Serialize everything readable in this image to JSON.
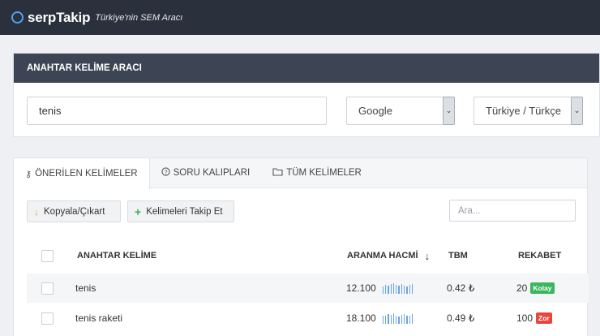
{
  "app": {
    "brand": "serpTakip",
    "tagline": "Türkiye'nin SEM Aracı"
  },
  "tool": {
    "title": "ANAHTAR KELİME ARACI",
    "keyword": "tenis",
    "engine": "Google",
    "country": "Türkiye / Türkçe"
  },
  "tabs": [
    {
      "label": "ÖNERİLEN KELİMELER",
      "icon": "key-icon",
      "active": true
    },
    {
      "label": "SORU KALIPLARI",
      "icon": "question-circle-icon",
      "active": false
    },
    {
      "label": "TÜM KELİMELER",
      "icon": "folder-icon",
      "active": false
    }
  ],
  "toolbar": {
    "copy_label": "Kopyala/Çıkart",
    "track_label": "Kelimeleri Takip Et",
    "search_placeholder": "Ara..."
  },
  "table": {
    "columns": {
      "keyword": "ANAHTAR KELİME",
      "volume": "ARANMA HACMİ",
      "cpc": "TBM",
      "competition": "REKABET"
    },
    "rows": [
      {
        "keyword": "tenis",
        "volume": "12.100",
        "cpc": "0.42 ₺",
        "competition": "20",
        "level": "Kolay",
        "level_color": "#3cb55c",
        "trend": [
          0.7,
          0.85,
          0.8,
          0.9,
          1,
          0.85,
          0.75,
          0.9,
          0.8,
          0.7,
          0.85,
          0.9
        ]
      },
      {
        "keyword": "tenis raketi",
        "volume": "18.100",
        "cpc": "0.49 ₺",
        "competition": "100",
        "level": "Zor",
        "level_color": "#e8463c",
        "trend": [
          0.75,
          0.8,
          0.9,
          0.85,
          1,
          0.8,
          0.7,
          0.85,
          0.9,
          0.75,
          0.8,
          0.95
        ]
      }
    ]
  },
  "colors": {
    "topbar": "#2a303c",
    "accent": "#4ea3f1",
    "panel_header": "#3d4555",
    "sparkline": "#6aa3df"
  }
}
